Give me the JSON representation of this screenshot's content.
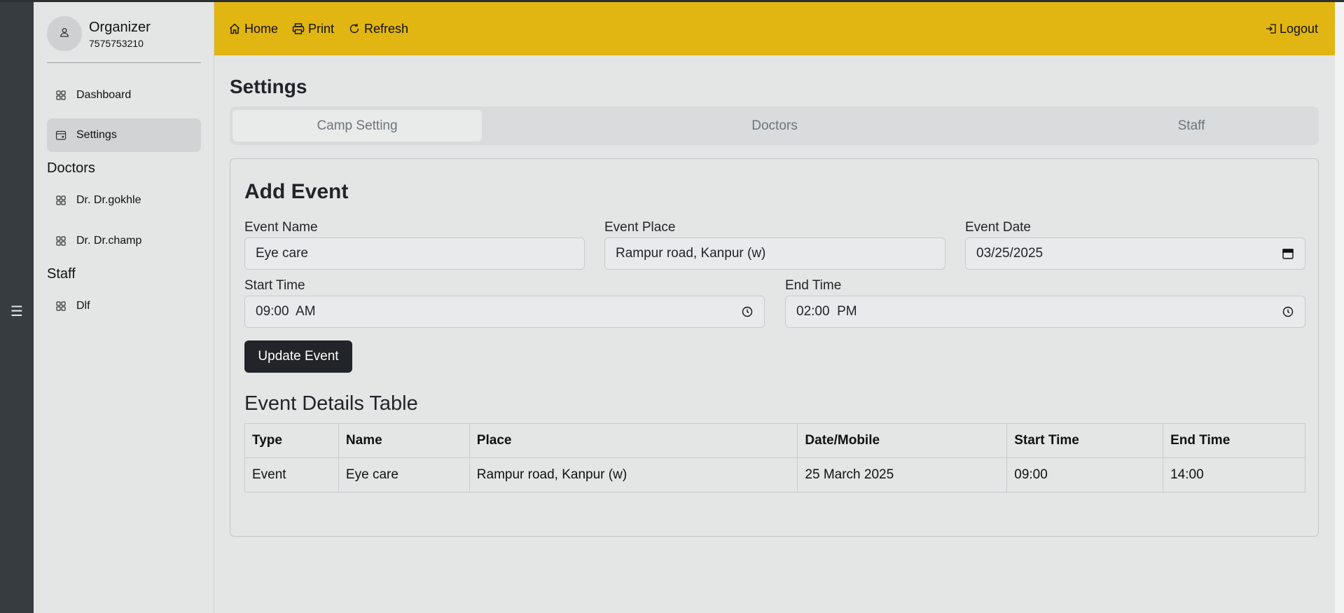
{
  "rail": {
    "menu_icon": "hamburger-icon"
  },
  "profile": {
    "name": "Organizer",
    "mobile": "7575753210",
    "icon": "user-icon"
  },
  "sidebar": {
    "items": [
      {
        "label": "Dashboard",
        "icon": "grid-icon"
      },
      {
        "label": "Settings",
        "icon": "calendar-icon"
      }
    ],
    "doctors_heading": "Doctors",
    "doctors": [
      {
        "label": "Dr. Dr.gokhle",
        "icon": "grid-icon"
      },
      {
        "label": "Dr. Dr.champ",
        "icon": "grid-icon"
      }
    ],
    "staff_heading": "Staff",
    "staff": [
      {
        "label": "Dlf",
        "icon": "grid-icon"
      }
    ]
  },
  "topbar": {
    "home_label": "Home",
    "print_label": "Print",
    "refresh_label": "Refresh",
    "logout_label": "Logout",
    "color": "#e1b512"
  },
  "page": {
    "title": "Settings"
  },
  "tabs": [
    {
      "label": "Camp Setting",
      "active": true
    },
    {
      "label": "Doctors",
      "active": false
    },
    {
      "label": "Staff",
      "active": false
    }
  ],
  "form": {
    "title": "Add Event",
    "event_name_label": "Event Name",
    "event_name_value": "Eye care",
    "event_place_label": "Event Place",
    "event_place_value": "Rampur road, Kanpur (w)",
    "event_date_label": "Event Date",
    "event_date_value": "03/25/2025",
    "start_time_label": "Start Time",
    "start_time_value": "09:00  AM",
    "end_time_label": "End Time",
    "end_time_value": "02:00  PM",
    "update_button": "Update Event"
  },
  "table": {
    "title": "Event Details Table",
    "headers": [
      "Type",
      "Name",
      "Place",
      "Date/Mobile",
      "Start Time",
      "End Time"
    ],
    "rows": [
      [
        "Event",
        "Eye care",
        "Rampur road, Kanpur (w)",
        "25 March 2025",
        "09:00",
        "14:00"
      ]
    ]
  }
}
